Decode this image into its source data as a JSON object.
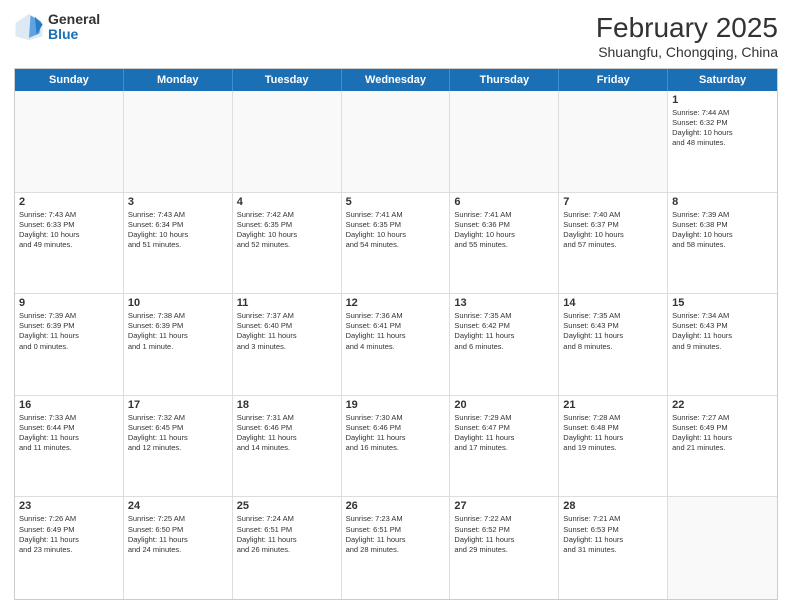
{
  "header": {
    "logo": {
      "general": "General",
      "blue": "Blue"
    },
    "title": "February 2025",
    "subtitle": "Shuangfu, Chongqing, China"
  },
  "dayNames": [
    "Sunday",
    "Monday",
    "Tuesday",
    "Wednesday",
    "Thursday",
    "Friday",
    "Saturday"
  ],
  "weeks": [
    [
      {
        "date": "",
        "info": ""
      },
      {
        "date": "",
        "info": ""
      },
      {
        "date": "",
        "info": ""
      },
      {
        "date": "",
        "info": ""
      },
      {
        "date": "",
        "info": ""
      },
      {
        "date": "",
        "info": ""
      },
      {
        "date": "1",
        "info": "Sunrise: 7:44 AM\nSunset: 6:32 PM\nDaylight: 10 hours\nand 48 minutes."
      }
    ],
    [
      {
        "date": "2",
        "info": "Sunrise: 7:43 AM\nSunset: 6:33 PM\nDaylight: 10 hours\nand 49 minutes."
      },
      {
        "date": "3",
        "info": "Sunrise: 7:43 AM\nSunset: 6:34 PM\nDaylight: 10 hours\nand 51 minutes."
      },
      {
        "date": "4",
        "info": "Sunrise: 7:42 AM\nSunset: 6:35 PM\nDaylight: 10 hours\nand 52 minutes."
      },
      {
        "date": "5",
        "info": "Sunrise: 7:41 AM\nSunset: 6:35 PM\nDaylight: 10 hours\nand 54 minutes."
      },
      {
        "date": "6",
        "info": "Sunrise: 7:41 AM\nSunset: 6:36 PM\nDaylight: 10 hours\nand 55 minutes."
      },
      {
        "date": "7",
        "info": "Sunrise: 7:40 AM\nSunset: 6:37 PM\nDaylight: 10 hours\nand 57 minutes."
      },
      {
        "date": "8",
        "info": "Sunrise: 7:39 AM\nSunset: 6:38 PM\nDaylight: 10 hours\nand 58 minutes."
      }
    ],
    [
      {
        "date": "9",
        "info": "Sunrise: 7:39 AM\nSunset: 6:39 PM\nDaylight: 11 hours\nand 0 minutes."
      },
      {
        "date": "10",
        "info": "Sunrise: 7:38 AM\nSunset: 6:39 PM\nDaylight: 11 hours\nand 1 minute."
      },
      {
        "date": "11",
        "info": "Sunrise: 7:37 AM\nSunset: 6:40 PM\nDaylight: 11 hours\nand 3 minutes."
      },
      {
        "date": "12",
        "info": "Sunrise: 7:36 AM\nSunset: 6:41 PM\nDaylight: 11 hours\nand 4 minutes."
      },
      {
        "date": "13",
        "info": "Sunrise: 7:35 AM\nSunset: 6:42 PM\nDaylight: 11 hours\nand 6 minutes."
      },
      {
        "date": "14",
        "info": "Sunrise: 7:35 AM\nSunset: 6:43 PM\nDaylight: 11 hours\nand 8 minutes."
      },
      {
        "date": "15",
        "info": "Sunrise: 7:34 AM\nSunset: 6:43 PM\nDaylight: 11 hours\nand 9 minutes."
      }
    ],
    [
      {
        "date": "16",
        "info": "Sunrise: 7:33 AM\nSunset: 6:44 PM\nDaylight: 11 hours\nand 11 minutes."
      },
      {
        "date": "17",
        "info": "Sunrise: 7:32 AM\nSunset: 6:45 PM\nDaylight: 11 hours\nand 12 minutes."
      },
      {
        "date": "18",
        "info": "Sunrise: 7:31 AM\nSunset: 6:46 PM\nDaylight: 11 hours\nand 14 minutes."
      },
      {
        "date": "19",
        "info": "Sunrise: 7:30 AM\nSunset: 6:46 PM\nDaylight: 11 hours\nand 16 minutes."
      },
      {
        "date": "20",
        "info": "Sunrise: 7:29 AM\nSunset: 6:47 PM\nDaylight: 11 hours\nand 17 minutes."
      },
      {
        "date": "21",
        "info": "Sunrise: 7:28 AM\nSunset: 6:48 PM\nDaylight: 11 hours\nand 19 minutes."
      },
      {
        "date": "22",
        "info": "Sunrise: 7:27 AM\nSunset: 6:49 PM\nDaylight: 11 hours\nand 21 minutes."
      }
    ],
    [
      {
        "date": "23",
        "info": "Sunrise: 7:26 AM\nSunset: 6:49 PM\nDaylight: 11 hours\nand 23 minutes."
      },
      {
        "date": "24",
        "info": "Sunrise: 7:25 AM\nSunset: 6:50 PM\nDaylight: 11 hours\nand 24 minutes."
      },
      {
        "date": "25",
        "info": "Sunrise: 7:24 AM\nSunset: 6:51 PM\nDaylight: 11 hours\nand 26 minutes."
      },
      {
        "date": "26",
        "info": "Sunrise: 7:23 AM\nSunset: 6:51 PM\nDaylight: 11 hours\nand 28 minutes."
      },
      {
        "date": "27",
        "info": "Sunrise: 7:22 AM\nSunset: 6:52 PM\nDaylight: 11 hours\nand 29 minutes."
      },
      {
        "date": "28",
        "info": "Sunrise: 7:21 AM\nSunset: 6:53 PM\nDaylight: 11 hours\nand 31 minutes."
      },
      {
        "date": "",
        "info": ""
      }
    ]
  ]
}
